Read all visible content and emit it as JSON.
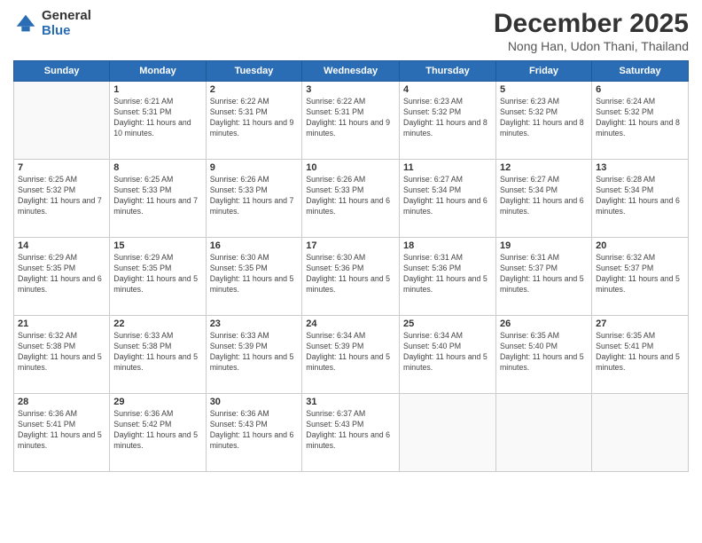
{
  "logo": {
    "general": "General",
    "blue": "Blue"
  },
  "header": {
    "month": "December 2025",
    "location": "Nong Han, Udon Thani, Thailand"
  },
  "days_of_week": [
    "Sunday",
    "Monday",
    "Tuesday",
    "Wednesday",
    "Thursday",
    "Friday",
    "Saturday"
  ],
  "weeks": [
    [
      {
        "day": "",
        "sunrise": "",
        "sunset": "",
        "daylight": ""
      },
      {
        "day": "1",
        "sunrise": "Sunrise: 6:21 AM",
        "sunset": "Sunset: 5:31 PM",
        "daylight": "Daylight: 11 hours and 10 minutes."
      },
      {
        "day": "2",
        "sunrise": "Sunrise: 6:22 AM",
        "sunset": "Sunset: 5:31 PM",
        "daylight": "Daylight: 11 hours and 9 minutes."
      },
      {
        "day": "3",
        "sunrise": "Sunrise: 6:22 AM",
        "sunset": "Sunset: 5:31 PM",
        "daylight": "Daylight: 11 hours and 9 minutes."
      },
      {
        "day": "4",
        "sunrise": "Sunrise: 6:23 AM",
        "sunset": "Sunset: 5:32 PM",
        "daylight": "Daylight: 11 hours and 8 minutes."
      },
      {
        "day": "5",
        "sunrise": "Sunrise: 6:23 AM",
        "sunset": "Sunset: 5:32 PM",
        "daylight": "Daylight: 11 hours and 8 minutes."
      },
      {
        "day": "6",
        "sunrise": "Sunrise: 6:24 AM",
        "sunset": "Sunset: 5:32 PM",
        "daylight": "Daylight: 11 hours and 8 minutes."
      }
    ],
    [
      {
        "day": "7",
        "sunrise": "Sunrise: 6:25 AM",
        "sunset": "Sunset: 5:32 PM",
        "daylight": "Daylight: 11 hours and 7 minutes."
      },
      {
        "day": "8",
        "sunrise": "Sunrise: 6:25 AM",
        "sunset": "Sunset: 5:33 PM",
        "daylight": "Daylight: 11 hours and 7 minutes."
      },
      {
        "day": "9",
        "sunrise": "Sunrise: 6:26 AM",
        "sunset": "Sunset: 5:33 PM",
        "daylight": "Daylight: 11 hours and 7 minutes."
      },
      {
        "day": "10",
        "sunrise": "Sunrise: 6:26 AM",
        "sunset": "Sunset: 5:33 PM",
        "daylight": "Daylight: 11 hours and 6 minutes."
      },
      {
        "day": "11",
        "sunrise": "Sunrise: 6:27 AM",
        "sunset": "Sunset: 5:34 PM",
        "daylight": "Daylight: 11 hours and 6 minutes."
      },
      {
        "day": "12",
        "sunrise": "Sunrise: 6:27 AM",
        "sunset": "Sunset: 5:34 PM",
        "daylight": "Daylight: 11 hours and 6 minutes."
      },
      {
        "day": "13",
        "sunrise": "Sunrise: 6:28 AM",
        "sunset": "Sunset: 5:34 PM",
        "daylight": "Daylight: 11 hours and 6 minutes."
      }
    ],
    [
      {
        "day": "14",
        "sunrise": "Sunrise: 6:29 AM",
        "sunset": "Sunset: 5:35 PM",
        "daylight": "Daylight: 11 hours and 6 minutes."
      },
      {
        "day": "15",
        "sunrise": "Sunrise: 6:29 AM",
        "sunset": "Sunset: 5:35 PM",
        "daylight": "Daylight: 11 hours and 5 minutes."
      },
      {
        "day": "16",
        "sunrise": "Sunrise: 6:30 AM",
        "sunset": "Sunset: 5:35 PM",
        "daylight": "Daylight: 11 hours and 5 minutes."
      },
      {
        "day": "17",
        "sunrise": "Sunrise: 6:30 AM",
        "sunset": "Sunset: 5:36 PM",
        "daylight": "Daylight: 11 hours and 5 minutes."
      },
      {
        "day": "18",
        "sunrise": "Sunrise: 6:31 AM",
        "sunset": "Sunset: 5:36 PM",
        "daylight": "Daylight: 11 hours and 5 minutes."
      },
      {
        "day": "19",
        "sunrise": "Sunrise: 6:31 AM",
        "sunset": "Sunset: 5:37 PM",
        "daylight": "Daylight: 11 hours and 5 minutes."
      },
      {
        "day": "20",
        "sunrise": "Sunrise: 6:32 AM",
        "sunset": "Sunset: 5:37 PM",
        "daylight": "Daylight: 11 hours and 5 minutes."
      }
    ],
    [
      {
        "day": "21",
        "sunrise": "Sunrise: 6:32 AM",
        "sunset": "Sunset: 5:38 PM",
        "daylight": "Daylight: 11 hours and 5 minutes."
      },
      {
        "day": "22",
        "sunrise": "Sunrise: 6:33 AM",
        "sunset": "Sunset: 5:38 PM",
        "daylight": "Daylight: 11 hours and 5 minutes."
      },
      {
        "day": "23",
        "sunrise": "Sunrise: 6:33 AM",
        "sunset": "Sunset: 5:39 PM",
        "daylight": "Daylight: 11 hours and 5 minutes."
      },
      {
        "day": "24",
        "sunrise": "Sunrise: 6:34 AM",
        "sunset": "Sunset: 5:39 PM",
        "daylight": "Daylight: 11 hours and 5 minutes."
      },
      {
        "day": "25",
        "sunrise": "Sunrise: 6:34 AM",
        "sunset": "Sunset: 5:40 PM",
        "daylight": "Daylight: 11 hours and 5 minutes."
      },
      {
        "day": "26",
        "sunrise": "Sunrise: 6:35 AM",
        "sunset": "Sunset: 5:40 PM",
        "daylight": "Daylight: 11 hours and 5 minutes."
      },
      {
        "day": "27",
        "sunrise": "Sunrise: 6:35 AM",
        "sunset": "Sunset: 5:41 PM",
        "daylight": "Daylight: 11 hours and 5 minutes."
      }
    ],
    [
      {
        "day": "28",
        "sunrise": "Sunrise: 6:36 AM",
        "sunset": "Sunset: 5:41 PM",
        "daylight": "Daylight: 11 hours and 5 minutes."
      },
      {
        "day": "29",
        "sunrise": "Sunrise: 6:36 AM",
        "sunset": "Sunset: 5:42 PM",
        "daylight": "Daylight: 11 hours and 5 minutes."
      },
      {
        "day": "30",
        "sunrise": "Sunrise: 6:36 AM",
        "sunset": "Sunset: 5:43 PM",
        "daylight": "Daylight: 11 hours and 6 minutes."
      },
      {
        "day": "31",
        "sunrise": "Sunrise: 6:37 AM",
        "sunset": "Sunset: 5:43 PM",
        "daylight": "Daylight: 11 hours and 6 minutes."
      },
      {
        "day": "",
        "sunrise": "",
        "sunset": "",
        "daylight": ""
      },
      {
        "day": "",
        "sunrise": "",
        "sunset": "",
        "daylight": ""
      },
      {
        "day": "",
        "sunrise": "",
        "sunset": "",
        "daylight": ""
      }
    ]
  ]
}
